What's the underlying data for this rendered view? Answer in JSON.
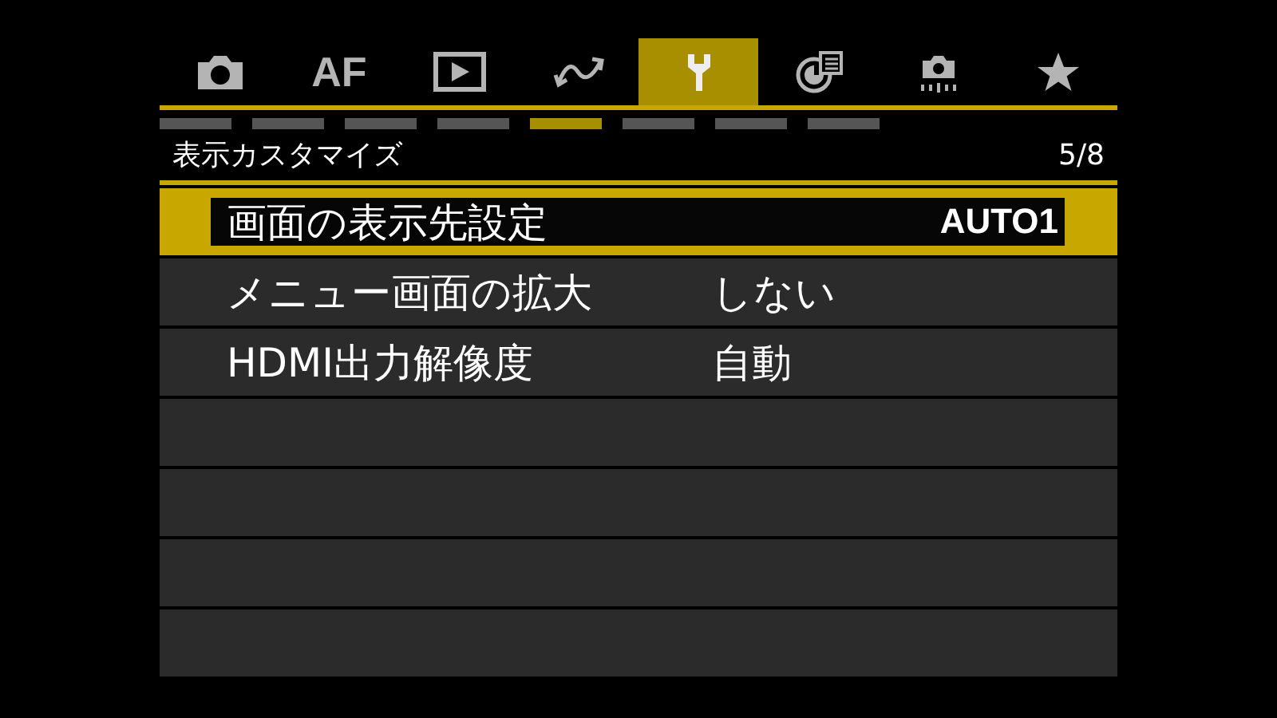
{
  "tabs": [
    {
      "kind": "camera",
      "selected": false
    },
    {
      "kind": "text",
      "label": "AF",
      "selected": false
    },
    {
      "kind": "playback",
      "selected": false
    },
    {
      "kind": "wave",
      "selected": false
    },
    {
      "kind": "wrench",
      "selected": true
    },
    {
      "kind": "dial",
      "selected": false
    },
    {
      "kind": "custom",
      "selected": false
    },
    {
      "kind": "star",
      "selected": false
    }
  ],
  "pages": [
    {
      "selected": false
    },
    {
      "selected": false
    },
    {
      "selected": false
    },
    {
      "selected": false
    },
    {
      "selected": true
    },
    {
      "selected": false
    },
    {
      "selected": false
    },
    {
      "selected": false
    }
  ],
  "header": {
    "title": "表示カスタマイズ",
    "page": "5/8"
  },
  "items": [
    {
      "label": "画面の表示先設定",
      "value": "AUTO1",
      "selected": true
    },
    {
      "label": "メニュー画面の拡大",
      "value": "しない",
      "selected": false
    },
    {
      "label": "HDMI出力解像度",
      "value": "自動",
      "selected": false
    }
  ]
}
